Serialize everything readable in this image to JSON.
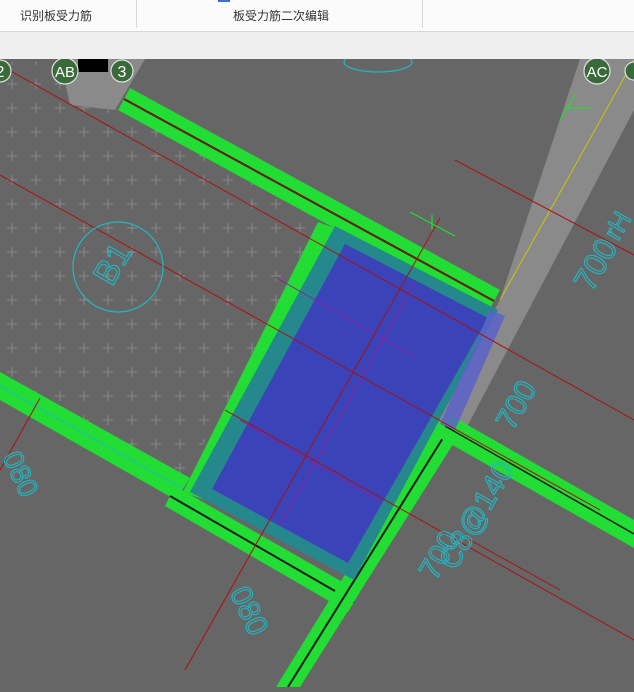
{
  "toolbar": {
    "tabs": [
      {
        "label": "识别板受力筋"
      },
      {
        "label": "板受力筋二次编辑"
      }
    ]
  },
  "axis_labels": {
    "a": "2",
    "b": "AB",
    "c": "3",
    "d": "AC"
  },
  "annotations": {
    "dim_700_right": "700",
    "dim_700_center": "700",
    "dim_700_bottom": "700",
    "dim_080_left": "080",
    "dim_080_bottom": "080",
    "beam_mark": "C8@140",
    "slab_mark": "B1",
    "partial_char": "rH"
  },
  "colors": {
    "background": "#666666",
    "beam_green": "#22dd33",
    "slab_blue": "#3a44b8",
    "teal_border": "#25888c",
    "cyan_text": "#21b8c4",
    "axis_red": "#aa1111"
  }
}
